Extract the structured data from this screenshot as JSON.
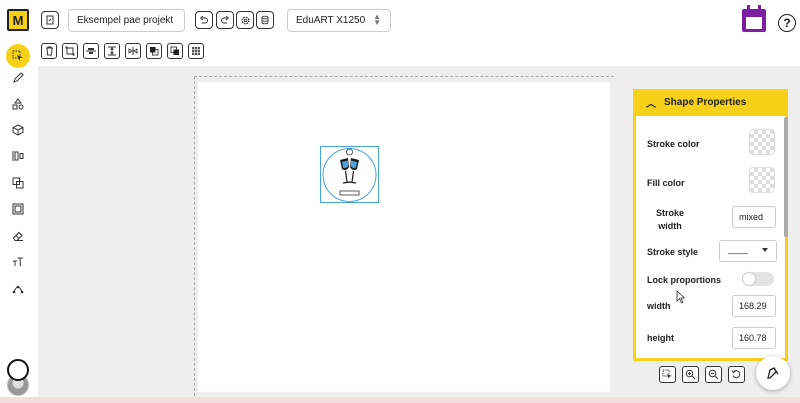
{
  "app": {
    "logo_text": "M",
    "project_name": "Eksempel pae projekt",
    "machine": "EduART X1250",
    "help_label": "?"
  },
  "colors": {
    "accent": "#f7d117",
    "brand_purple": "#7b1fa2",
    "selection": "#4aa3d6"
  },
  "top_icons": [
    "document-icon",
    "undo-icon",
    "redo-icon",
    "settings-icon",
    "database-icon",
    "calendar-icon",
    "help-icon"
  ],
  "toolbar_icons": [
    "delete-icon",
    "group-icon",
    "align-center-h-icon",
    "align-center-v-icon",
    "flip-h-icon",
    "bring-front-icon",
    "send-back-icon",
    "grid-icon"
  ],
  "sidebar_icons": [
    "select-icon",
    "pen-icon",
    "shapes-icon",
    "cube-icon",
    "align-icon",
    "boolean-icon",
    "frame-icon",
    "eraser-icon",
    "text-icon",
    "node-icon"
  ],
  "panel": {
    "title": "Shape Properties",
    "stroke_color_label": "Stroke color",
    "fill_color_label": "Fill color",
    "stroke_width_label": "Stroke width",
    "stroke_width_value": "mixed",
    "stroke_style_label": "Stroke style",
    "stroke_style_value": "____",
    "lock_label": "Lock proportions",
    "lock_on": false,
    "width_label": "width",
    "width_value": "168.29",
    "height_label": "height",
    "height_value": "160.78"
  },
  "zoom_icons": [
    "select-all-icon",
    "zoom-in-icon",
    "zoom-out-icon",
    "reset-view-icon",
    "panel-toggle-icon"
  ]
}
